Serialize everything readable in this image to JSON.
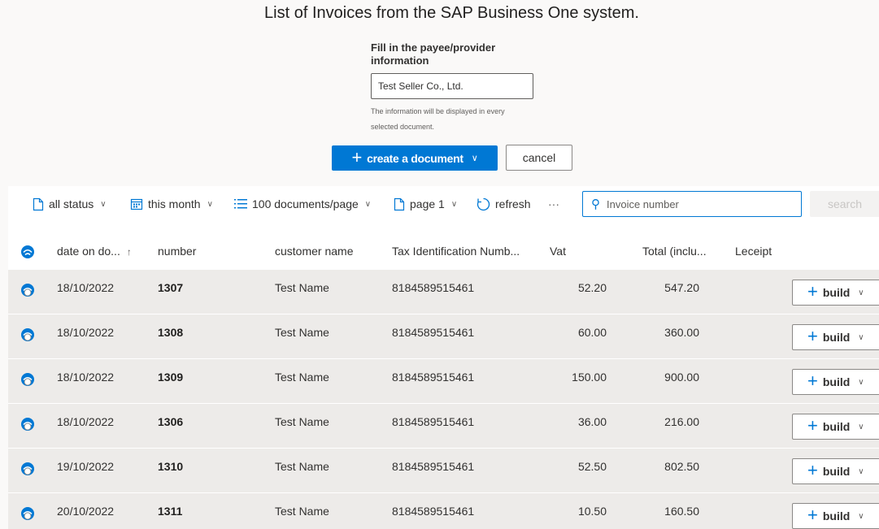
{
  "page": {
    "title": "List of Invoices from the SAP Business One system."
  },
  "payee": {
    "label": "Fill in the payee/provider information",
    "value": "Test Seller Co., Ltd.",
    "help": "The information will be displayed in every selected document."
  },
  "actions": {
    "create_label": "create a document",
    "cancel_label": "cancel"
  },
  "toolbar": {
    "status_label": "all status",
    "period_label": "this month",
    "page_size_label": "100 documents/page",
    "page_label": "page 1",
    "refresh_label": "refresh",
    "more_label": "···",
    "search_placeholder": "Invoice number",
    "search_button_label": "search"
  },
  "table": {
    "columns": {
      "date": "date on do...",
      "number": "number",
      "customer": "customer name",
      "tax_id": "Tax Identification Numb...",
      "vat": "Vat",
      "total": "Total (inclu...",
      "receipt": "Leceipt"
    },
    "build_label": "build",
    "rows": [
      {
        "date": "18/10/2022",
        "number": "1307",
        "customer": "Test Name",
        "tax_id": "8184589515461",
        "vat": "52.20",
        "total": "547.20"
      },
      {
        "date": "18/10/2022",
        "number": "1308",
        "customer": "Test Name",
        "tax_id": "8184589515461",
        "vat": "60.00",
        "total": "360.00"
      },
      {
        "date": "18/10/2022",
        "number": "1309",
        "customer": "Test Name",
        "tax_id": "8184589515461",
        "vat": "150.00",
        "total": "900.00"
      },
      {
        "date": "18/10/2022",
        "number": "1306",
        "customer": "Test Name",
        "tax_id": "8184589515461",
        "vat": "36.00",
        "total": "216.00"
      },
      {
        "date": "19/10/2022",
        "number": "1310",
        "customer": "Test Name",
        "tax_id": "8184589515461",
        "vat": "52.50",
        "total": "802.50"
      },
      {
        "date": "20/10/2022",
        "number": "1311",
        "customer": "Test Name",
        "tax_id": "8184589515461",
        "vat": "10.50",
        "total": "160.50"
      }
    ]
  },
  "colors": {
    "accent": "#0078d4",
    "row_bg": "#edebe9",
    "page_bg": "#faf9f8"
  }
}
